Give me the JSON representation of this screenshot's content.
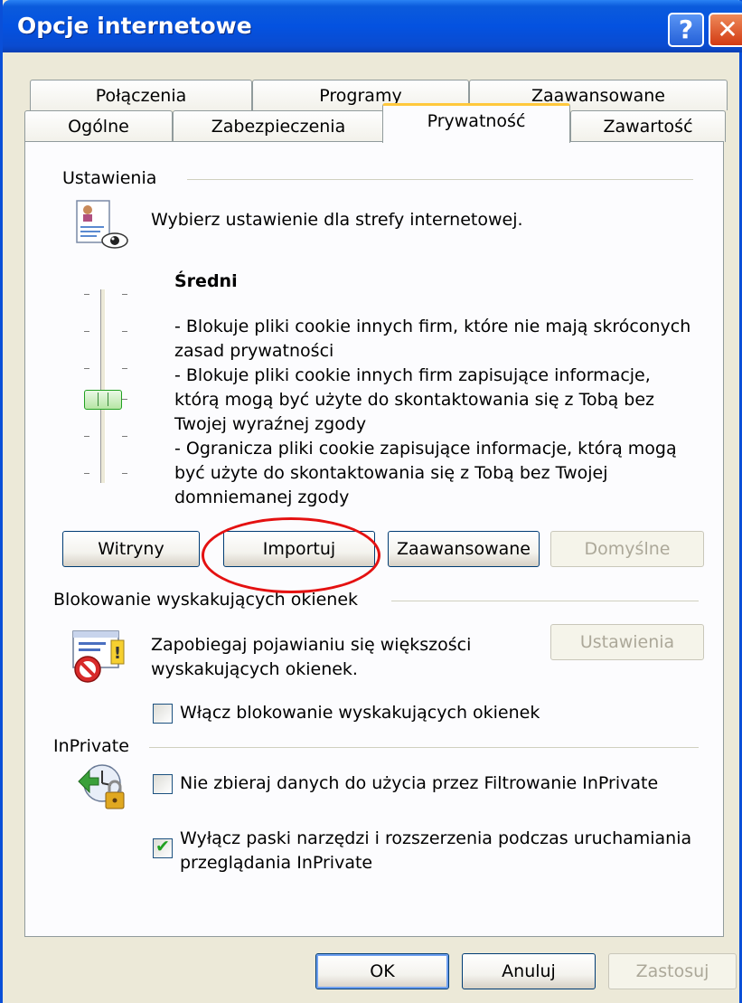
{
  "window": {
    "title": "Opcje internetowe",
    "help_glyph": "?",
    "close_glyph": "✕"
  },
  "tabs": {
    "row1": [
      {
        "label": "Połączenia"
      },
      {
        "label": "Programy"
      },
      {
        "label": "Zaawansowane"
      }
    ],
    "row2": [
      {
        "label": "Ogólne"
      },
      {
        "label": "Zabezpieczenia"
      },
      {
        "label": "Prywatność",
        "active": true
      },
      {
        "label": "Zawartość"
      }
    ]
  },
  "settings": {
    "group_label": "Ustawienia",
    "description": "Wybierz ustawienie dla strefy internetowej.",
    "level_name": "Średni",
    "level_lines": [
      "- Blokuje pliki cookie innych firm, które nie mają skróconych",
      "zasad prywatności",
      "- Blokuje pliki cookie innych firm zapisujące informacje,",
      "którą mogą być użyte do skontaktowania się z Tobą bez",
      "Twojej wyraźnej zgody",
      "- Ogranicza pliki cookie zapisujące informacje, którą mogą",
      "być użyte do skontaktowania się z Tobą bez Twojej",
      "domniemanej zgody"
    ],
    "buttons": {
      "sites": "Witryny",
      "import": "Importuj",
      "advanced": "Zaawansowane",
      "default": "Domyślne"
    }
  },
  "popup": {
    "group_label": "Blokowanie wyskakujących okienek",
    "description_lines": [
      "Zapobiegaj pojawianiu się większości",
      "wyskakujących okienek."
    ],
    "settings_button": "Ustawienia",
    "checkbox_label": "Włącz blokowanie wyskakujących okienek",
    "checkbox_checked": false
  },
  "inprivate": {
    "group_label": "InPrivate",
    "filter_label": "Nie zbieraj danych do użycia przez Filtrowanie InPrivate",
    "filter_checked": false,
    "toolbars_label_lines": [
      "Wyłącz paski narzędzi i rozszerzenia podczas uruchamiania",
      "przeglądania InPrivate"
    ],
    "toolbars_checked": true,
    "check_glyph": "✔"
  },
  "footer": {
    "ok": "OK",
    "cancel": "Anuluj",
    "apply": "Zastosuj"
  },
  "colors": {
    "titlebar": "#0452e0",
    "annotation": "#e41111",
    "active_tab_accent": "#ffc83c",
    "check": "#21a121"
  }
}
